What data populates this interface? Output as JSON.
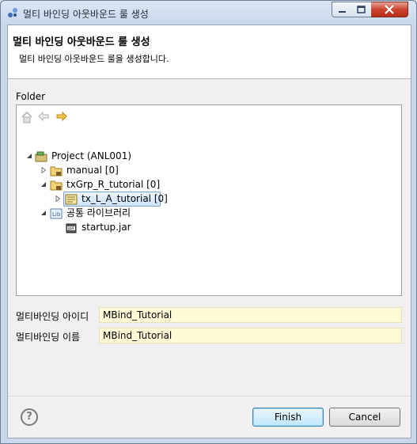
{
  "window": {
    "title": "멀티 바인딩 아웃바운드 룰 생성"
  },
  "header": {
    "title": "멀티 바인딩 아웃바운드 룰 생성",
    "description": "멀티 바인딩 아웃바운드 룰을 생성합니다."
  },
  "folder": {
    "label": "Folder",
    "toolbar_icons": [
      "home-icon",
      "back-arrow-icon",
      "forward-arrow-icon"
    ],
    "tree": [
      {
        "label": "Project  (ANL001)",
        "icon": "project-icon",
        "expanded": true,
        "selected": false
      },
      {
        "label": "manual [0]",
        "icon": "package-folder-icon",
        "expanded": false,
        "selected": false
      },
      {
        "label": "txGrp_R_tutorial [0]",
        "icon": "package-folder-icon",
        "expanded": true,
        "selected": false
      },
      {
        "label": "tx_L_A_tutorial [0]",
        "icon": "transaction-icon",
        "expanded": false,
        "selected": true
      },
      {
        "label": "공통 라이브러리",
        "icon": "library-icon",
        "expanded": true,
        "selected": false
      },
      {
        "label": "startup.jar",
        "icon": "jar-icon",
        "expanded": false,
        "selected": false
      }
    ]
  },
  "form": {
    "id_label": "멀티바인딩 아이디",
    "id_value": "MBind_Tutorial",
    "name_label": "멀티바인딩 이름",
    "name_value": "MBind_Tutorial"
  },
  "buttons": {
    "finish": "Finish",
    "cancel": "Cancel",
    "help": "?"
  }
}
